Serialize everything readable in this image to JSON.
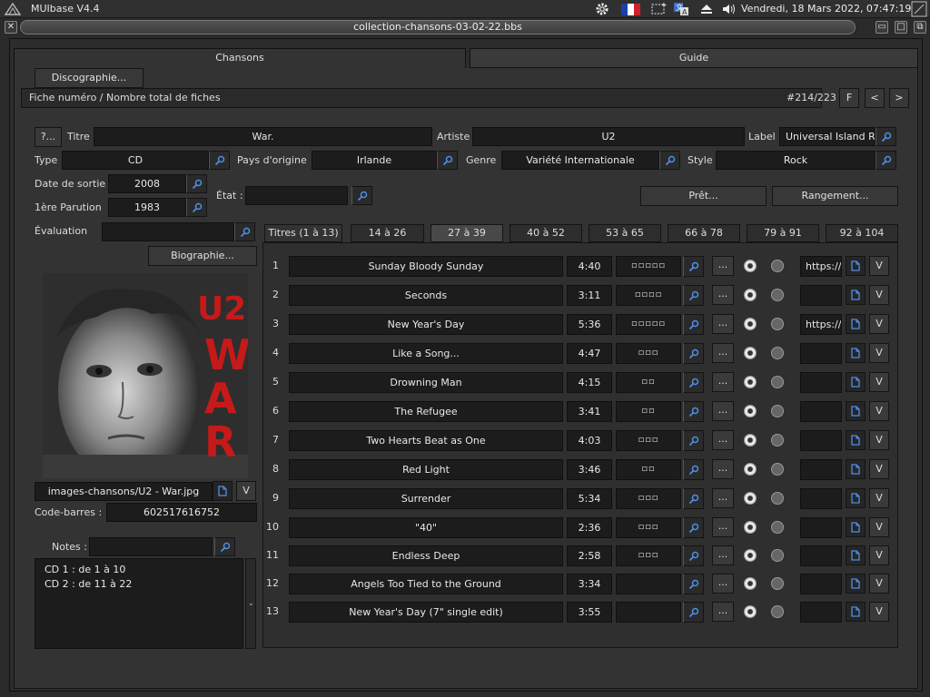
{
  "system_bar": {
    "app_name": "MUIbase V4.4",
    "datetime": "Vendredi, 18 Mars 2022, 07:47:19"
  },
  "window": {
    "title": "collection-chansons-03-02-22.bbs"
  },
  "main_tabs": [
    {
      "label": "Chansons"
    },
    {
      "label": "Guide"
    }
  ],
  "record_bar": {
    "label": "Fiche numéro / Nombre total de fiches",
    "counter": "#214/223",
    "filter_label": "F",
    "prev_label": "<",
    "next_label": ">"
  },
  "form": {
    "help_label": "?...",
    "titre_label": "Titre",
    "titre_value": "War.",
    "artiste_label": "Artiste",
    "artiste_value": "U2",
    "label_label": "Label",
    "label_value": "Universal Island R",
    "type_label": "Type",
    "type_value": "CD",
    "pays_label": "Pays d'origine",
    "pays_value": "Irlande",
    "genre_label": "Genre",
    "genre_value": "Variété Internationale",
    "style_label": "Style",
    "style_value": "Rock",
    "date_sortie_label": "Date de sortie",
    "date_sortie_value": "2008",
    "parution_label": "1ère Parution",
    "parution_value": "1983",
    "etat_label": "État :",
    "etat_value": "",
    "pret_label": "Prêt...",
    "rangement_label": "Rangement...",
    "evaluation_label": "Évaluation",
    "discographie_label": "Discographie...",
    "biographie_label": "Biographie...",
    "image_path": "images-chansons/U2 - War.jpg",
    "v_label": "V",
    "codebarres_label": "Code-barres :",
    "codebarres_value": "602517616752",
    "notes_label": "Notes :",
    "notes_line1": "CD 1 : de 1 à 10",
    "notes_line2": "CD 2 : de 11 à 22"
  },
  "album_art": {
    "band_text": "U2",
    "album_text": "WAR"
  },
  "track_tabs": [
    {
      "label": "Titres (1 à 13)"
    },
    {
      "label": "14 à 26"
    },
    {
      "label": "27 à 39"
    },
    {
      "label": "40 à 52"
    },
    {
      "label": "53 à 65"
    },
    {
      "label": "66 à 78"
    },
    {
      "label": "79 à 91"
    },
    {
      "label": "92 à 104"
    }
  ],
  "tracks": [
    {
      "num": "1",
      "title": "Sunday Bloody Sunday",
      "duration": "4:40",
      "rating": "◽◽◽◽◽",
      "radio": "left",
      "url": "https://"
    },
    {
      "num": "2",
      "title": "Seconds",
      "duration": "3:11",
      "rating": "◽◽◽◽",
      "radio": "left",
      "url": ""
    },
    {
      "num": "3",
      "title": "New Year's Day",
      "duration": "5:36",
      "rating": "◽◽◽◽◽",
      "radio": "left",
      "url": "https://"
    },
    {
      "num": "4",
      "title": "Like a Song...",
      "duration": "4:47",
      "rating": "◽◽◽",
      "radio": "left",
      "url": ""
    },
    {
      "num": "5",
      "title": "Drowning Man",
      "duration": "4:15",
      "rating": "◽◽",
      "radio": "left",
      "url": ""
    },
    {
      "num": "6",
      "title": "The Refugee",
      "duration": "3:41",
      "rating": "◽◽",
      "radio": "left",
      "url": ""
    },
    {
      "num": "7",
      "title": "Two Hearts Beat as One",
      "duration": "4:03",
      "rating": "◽◽◽",
      "radio": "left",
      "url": ""
    },
    {
      "num": "8",
      "title": "Red Light",
      "duration": "3:46",
      "rating": "◽◽",
      "radio": "left",
      "url": ""
    },
    {
      "num": "9",
      "title": "Surrender",
      "duration": "5:34",
      "rating": "◽◽◽",
      "radio": "left",
      "url": ""
    },
    {
      "num": "10",
      "title": "\"40\"",
      "duration": "2:36",
      "rating": "◽◽◽",
      "radio": "left",
      "url": ""
    },
    {
      "num": "11",
      "title": "Endless Deep",
      "duration": "2:58",
      "rating": "◽◽◽",
      "radio": "left",
      "url": ""
    },
    {
      "num": "12",
      "title": "Angels Too Tied to the Ground",
      "duration": "3:34",
      "rating": "",
      "radio": "left",
      "url": ""
    },
    {
      "num": "13",
      "title": "New Year's Day (7\" single edit)",
      "duration": "3:55",
      "rating": "",
      "radio": "left",
      "url": ""
    }
  ],
  "row_labels": {
    "dots": "...",
    "v": "V"
  },
  "colors": {
    "accent_blue": "#4d8fe6",
    "album_red": "#c41a1a"
  }
}
